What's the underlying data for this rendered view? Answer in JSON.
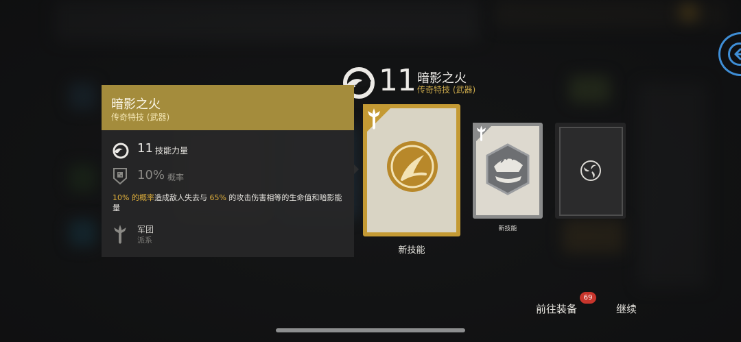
{
  "colors": {
    "accent_gold": "#c9a84a",
    "panel_header": "#a48c3c",
    "highlight": "#e2b13c",
    "badge_red": "#c8352c",
    "back_blue": "#3f8ed6"
  },
  "header": {
    "icon": "skill-swirl-icon",
    "level": "11",
    "title": "暗影之火",
    "subtitle": "传奇特技 (武器)"
  },
  "tooltip": {
    "title": "暗影之火",
    "subtitle": "传奇特技 (武器)",
    "stat_power": {
      "icon": "skill-swirl-icon",
      "value": "11",
      "label": "技能力量"
    },
    "stat_chance": {
      "icon": "shield-dice-icon",
      "value": "10%",
      "label": "概率"
    },
    "description": {
      "part1": "10% 的概率",
      "part2": "造成敌人失去与 ",
      "part3": "65%",
      "part4": " 的攻击伤害相等的生命值和暗影能量"
    },
    "faction": {
      "icon": "legion-sword-icon",
      "name": "军团",
      "label": "派系"
    }
  },
  "cards": {
    "main": {
      "icon": "shadowfire-blade-icon",
      "corner_icon": "legion-sword-icon",
      "label": "新技能"
    },
    "second": {
      "icon": "armor-crest-icon",
      "corner_icon": "legion-sword-icon",
      "label": "新技能"
    },
    "third": {
      "icon": "triskelion-icon"
    }
  },
  "buttons": {
    "back_icon": "back-arrow-icon",
    "equip_label": "前往装备",
    "equip_badge": "69",
    "continue_label": "继续"
  }
}
